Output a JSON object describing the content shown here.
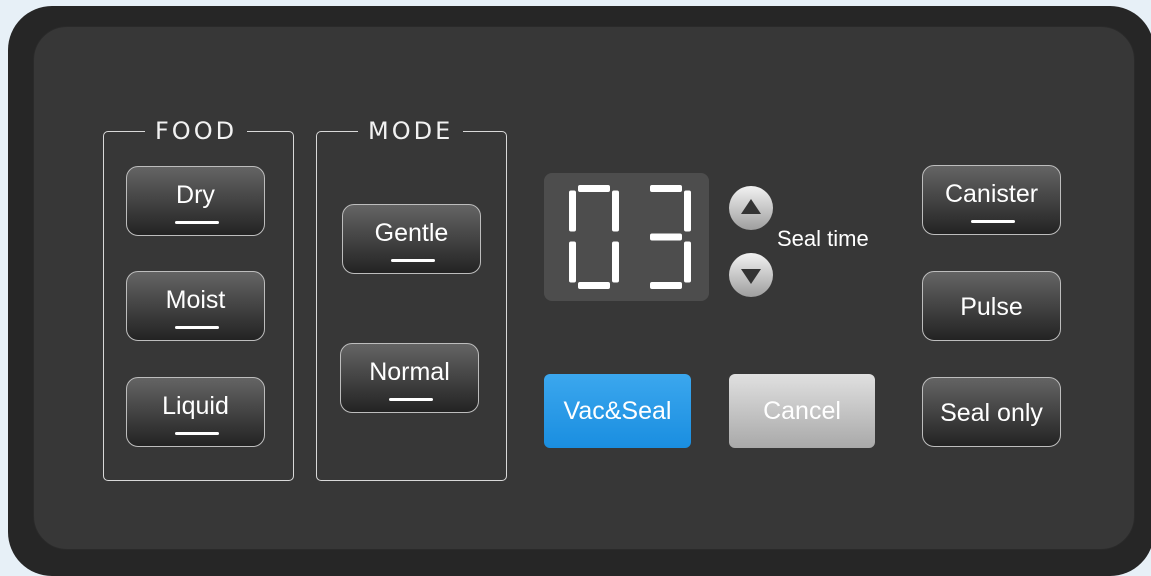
{
  "food": {
    "title": "FOOD",
    "buttons": [
      {
        "label": "Dry",
        "indicator": true
      },
      {
        "label": "Moist",
        "indicator": true
      },
      {
        "label": "Liquid",
        "indicator": true
      }
    ]
  },
  "mode": {
    "title": "MODE",
    "buttons": [
      {
        "label": "Gentle",
        "indicator": true
      },
      {
        "label": "Normal",
        "indicator": true
      }
    ]
  },
  "display": {
    "value": "03",
    "label": "Seal time",
    "up_icon": "up-triangle-icon",
    "down_icon": "down-triangle-icon"
  },
  "actions": {
    "vac_seal": "Vac&Seal",
    "cancel": "Cancel"
  },
  "right": {
    "buttons": [
      {
        "label": "Canister",
        "indicator": true
      },
      {
        "label": "Pulse",
        "indicator": false
      },
      {
        "label": "Seal only",
        "indicator": false
      }
    ]
  },
  "colors": {
    "accent": "#1e96e6",
    "panel": "#373737",
    "frame": "#262626",
    "background": "#e7f0f7"
  }
}
